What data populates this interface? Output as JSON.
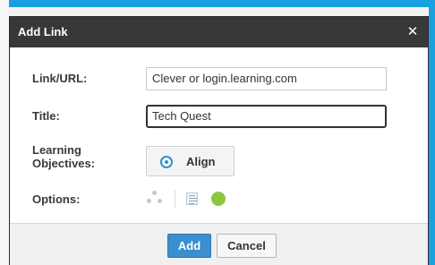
{
  "dialog": {
    "title": "Add Link",
    "close_icon": "close-icon",
    "link": {
      "label": "Link/URL:",
      "value": "Clever or login.learning.com"
    },
    "title_field": {
      "label": "Title:",
      "value": "Tech Quest"
    },
    "objectives": {
      "label_line1": "Learning",
      "label_line2": "Objectives:",
      "button_label": "Align",
      "button_icon": "target-icon"
    },
    "options": {
      "label": "Options:",
      "icons": [
        "dots-icon",
        "document-icon",
        "green-circle-icon"
      ]
    },
    "footer": {
      "add_label": "Add",
      "cancel_label": "Cancel"
    }
  },
  "colors": {
    "titlebar": "#383838",
    "accent": "#3a8fd0",
    "option_green": "#8dc63f",
    "page_edge": "#1aa0e0"
  }
}
